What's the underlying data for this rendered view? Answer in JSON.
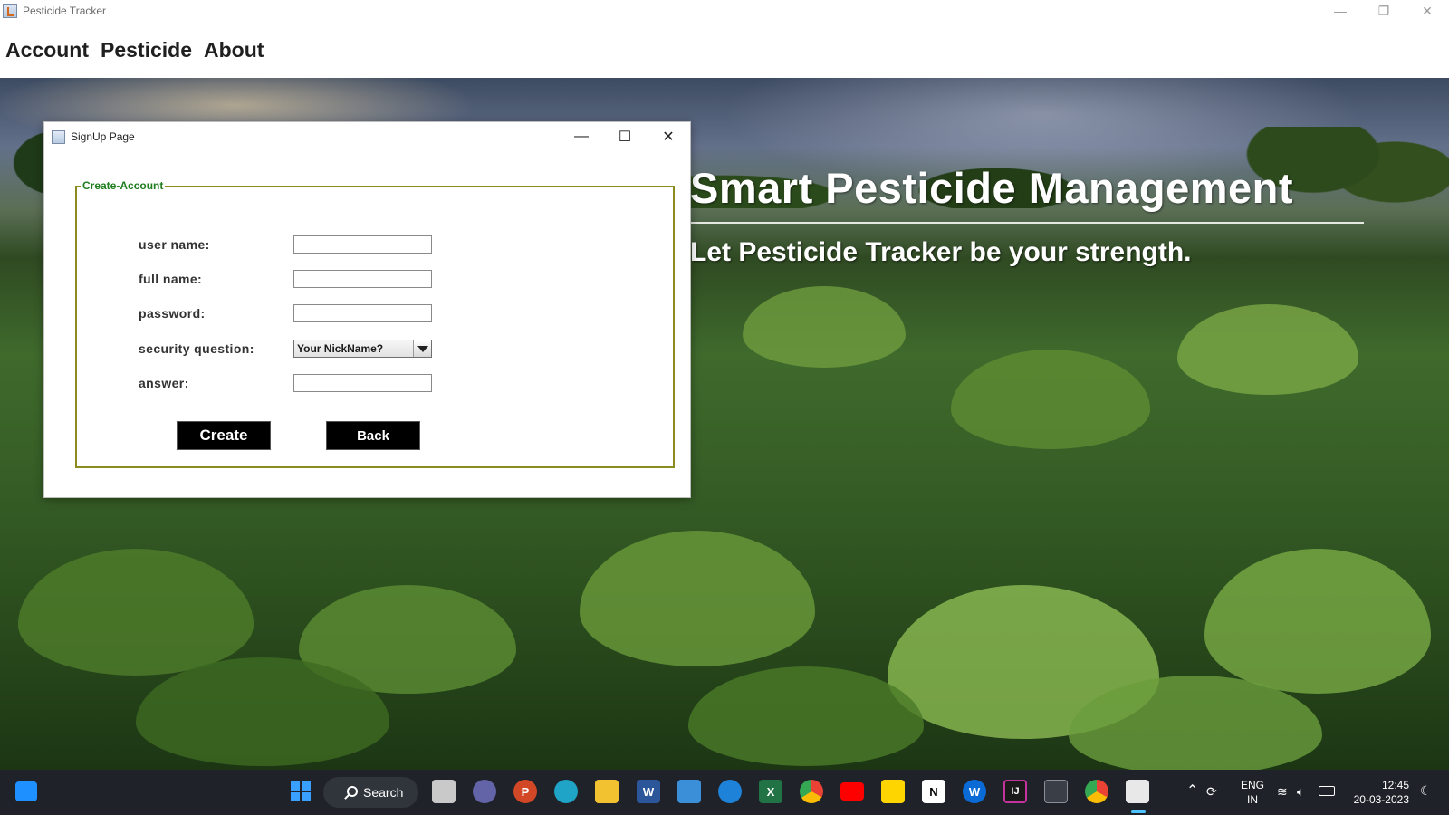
{
  "window": {
    "title": "Pesticide Tracker",
    "controls": {
      "minimize": "—",
      "restore": "❐",
      "close": "✕"
    }
  },
  "menu": {
    "items": [
      {
        "label": "Account"
      },
      {
        "label": "Pesticide"
      },
      {
        "label": "About"
      }
    ]
  },
  "background": {
    "headline": "Smart Pesticide Management",
    "tagline": "Let Pesticide Tracker be your strength."
  },
  "dialog": {
    "title": "SignUp Page",
    "controls": {
      "minimize": "—",
      "maximize": "☐",
      "close": "✕"
    },
    "group_title": "Create-Account",
    "fields": {
      "username": {
        "label": "user name:",
        "value": ""
      },
      "fullname": {
        "label": "full name:",
        "value": ""
      },
      "password": {
        "label": "password:",
        "value": ""
      },
      "security_question": {
        "label": "security question:",
        "selected": "Your NickName?"
      },
      "answer": {
        "label": "answer:",
        "value": ""
      }
    },
    "buttons": {
      "create": "Create",
      "back": "Back"
    }
  },
  "taskbar": {
    "search_label": "Search",
    "apps": [
      {
        "icon": "task-view-icon"
      },
      {
        "icon": "teams-icon"
      },
      {
        "icon": "powerpoint-icon",
        "glyph": "P"
      },
      {
        "icon": "edge-icon"
      },
      {
        "icon": "file-explorer-icon"
      },
      {
        "icon": "word-icon",
        "glyph": "W"
      },
      {
        "icon": "mail-icon"
      },
      {
        "icon": "safari-icon"
      },
      {
        "icon": "excel-icon",
        "glyph": "X"
      },
      {
        "icon": "chrome-icon"
      },
      {
        "icon": "youtube-icon"
      },
      {
        "icon": "sticky-notes-icon"
      },
      {
        "icon": "notion-icon",
        "glyph": "N"
      },
      {
        "icon": "webex-icon",
        "glyph": "W"
      },
      {
        "icon": "intellij-icon",
        "glyph": "IJ"
      },
      {
        "icon": "mysql-icon"
      },
      {
        "icon": "chrome-profile-icon"
      },
      {
        "icon": "java-icon"
      }
    ],
    "tray": {
      "language": "ENG",
      "region": "IN",
      "time": "12:45",
      "date": "20-03-2023"
    }
  }
}
